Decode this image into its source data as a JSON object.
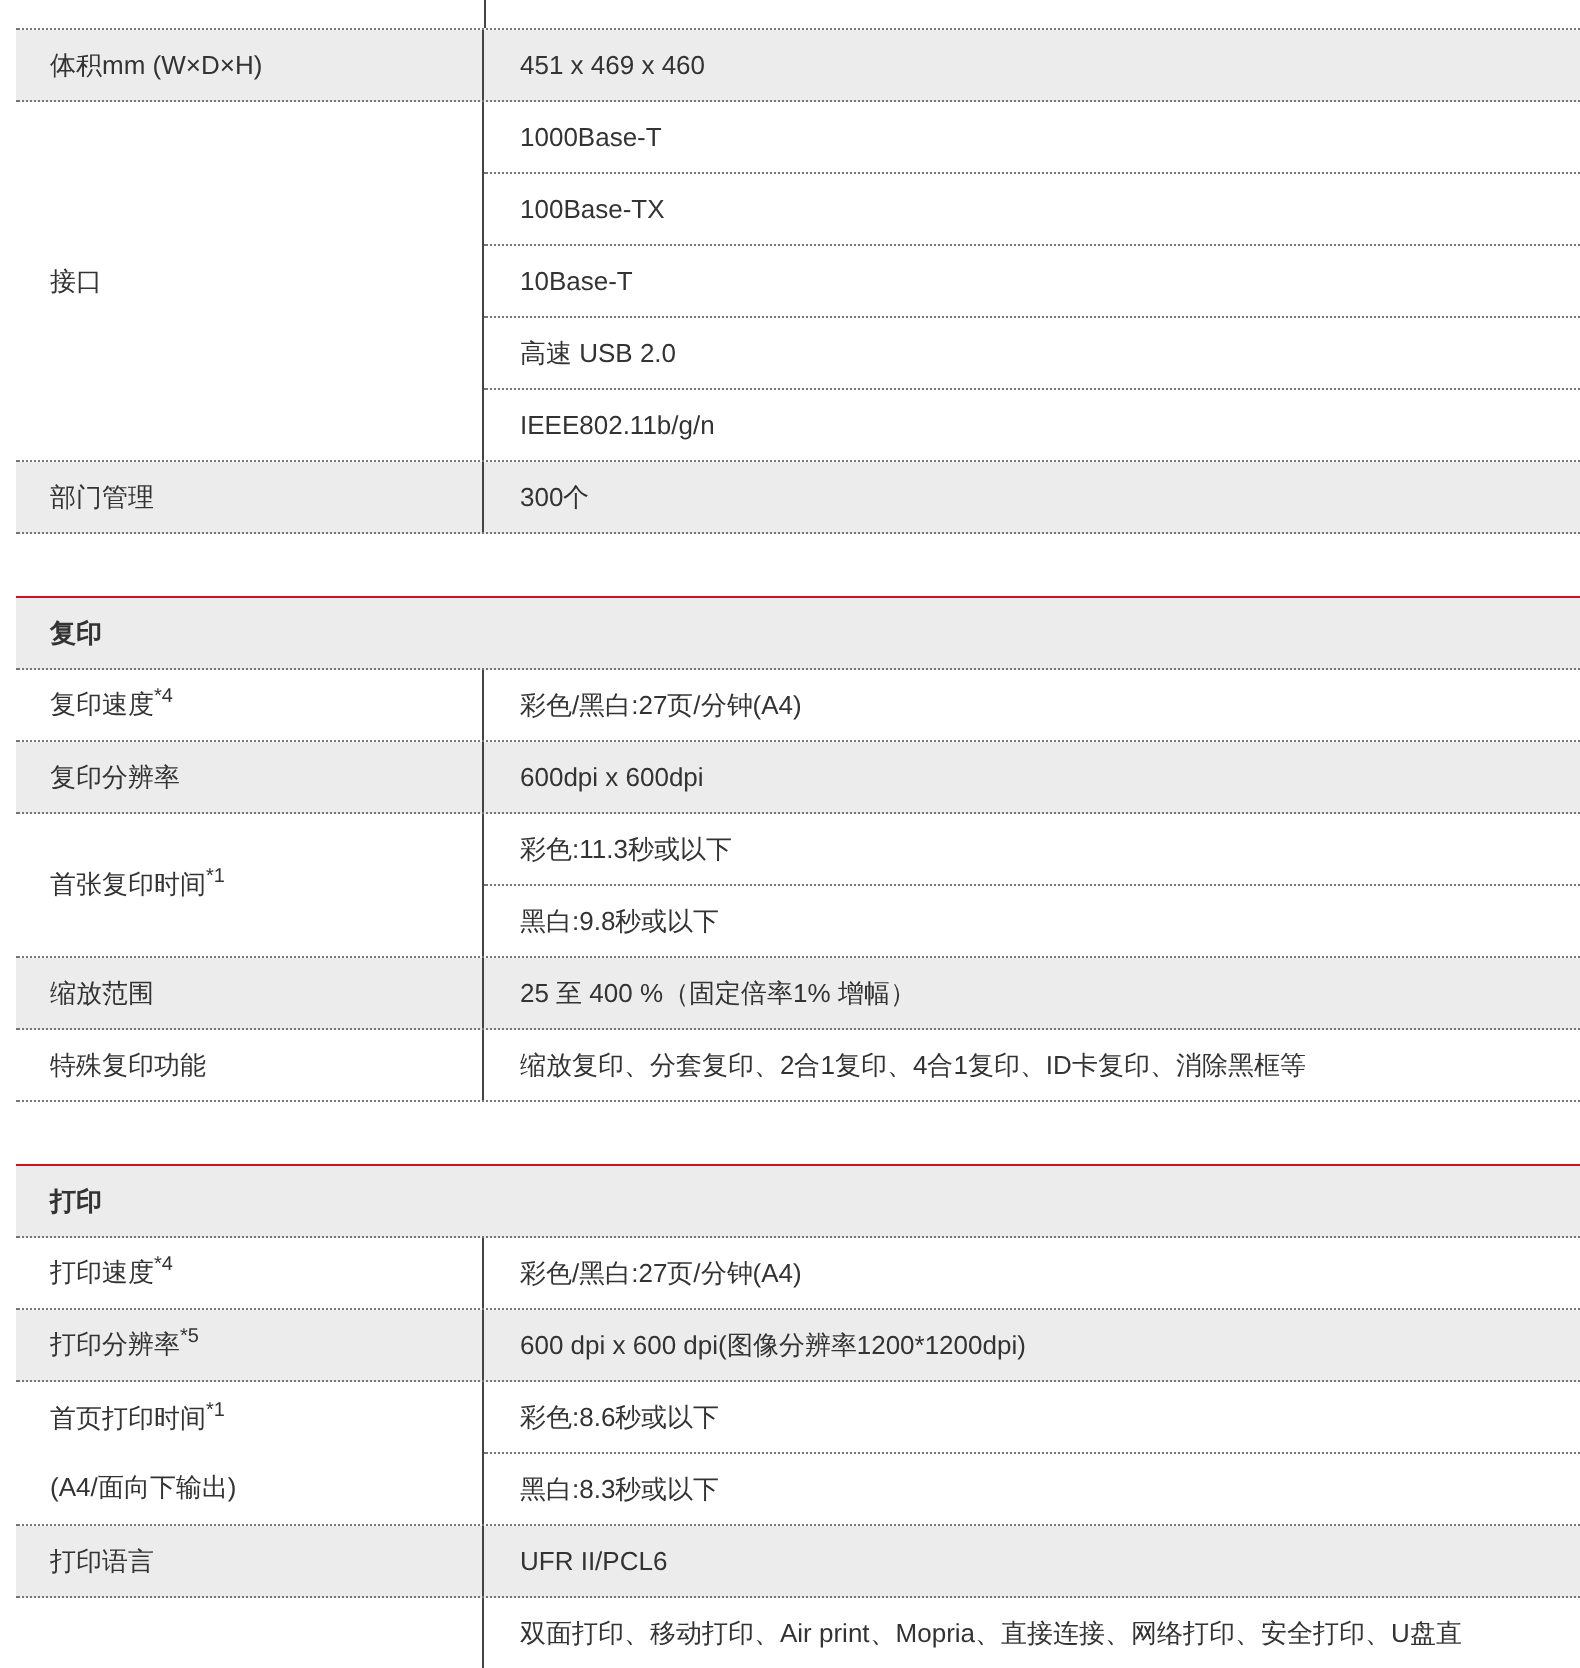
{
  "sections": [
    {
      "rows": [
        {
          "label": [
            "体积mm (W×D×H)"
          ],
          "values": [
            "451 x 469 x 460"
          ],
          "shaded": true
        },
        {
          "label": [
            "接口"
          ],
          "values": [
            "1000Base-T",
            "100Base-TX",
            "10Base-T",
            "高速 USB 2.0",
            "IEEE802.11b/g/n"
          ],
          "shaded": false
        },
        {
          "label": [
            "部门管理"
          ],
          "values": [
            "300个"
          ],
          "shaded": true
        }
      ]
    },
    {
      "title": "复印",
      "rows": [
        {
          "label": [
            "复印速度$^{*4}$"
          ],
          "values": [
            "彩色/黑白:27页/分钟(A4)"
          ],
          "shaded": false
        },
        {
          "label": [
            "复印分辨率"
          ],
          "values": [
            "600dpi x 600dpi"
          ],
          "shaded": true
        },
        {
          "label": [
            "首张复印时间$^{*1}$"
          ],
          "values": [
            "彩色:11.3秒或以下",
            "黑白:9.8秒或以下"
          ],
          "shaded": false
        },
        {
          "label": [
            "缩放范围"
          ],
          "values": [
            "25 至 400 %（固定倍率1% 增幅）"
          ],
          "shaded": true
        },
        {
          "label": [
            "特殊复印功能"
          ],
          "values": [
            "缩放复印、分套复印、2合1复印、4合1复印、ID卡复印、消除黑框等"
          ],
          "shaded": false
        }
      ]
    },
    {
      "title": "打印",
      "rows": [
        {
          "label": [
            "打印速度$^{*4}$"
          ],
          "values": [
            "彩色/黑白:27页/分钟(A4)"
          ],
          "shaded": false
        },
        {
          "label": [
            "打印分辨率$^{*5}$"
          ],
          "values": [
            "600 dpi x 600 dpi(图像分辨率1200*1200dpi)"
          ],
          "shaded": true
        },
        {
          "label": [
            "首页打印时间$^{*1}$",
            "(A4/面向下输出)"
          ],
          "values": [
            "彩色:8.6秒或以下",
            "黑白:8.3秒或以下"
          ],
          "shaded": false
        },
        {
          "label": [
            "打印语言"
          ],
          "values": [
            "UFR II/PCL6"
          ],
          "shaded": true
        },
        {
          "label": [],
          "values": [
            "双面打印、移动打印、Air print、Mopria、直接连接、网络打印、安全打印、U盘直"
          ],
          "shaded": false
        }
      ]
    }
  ]
}
